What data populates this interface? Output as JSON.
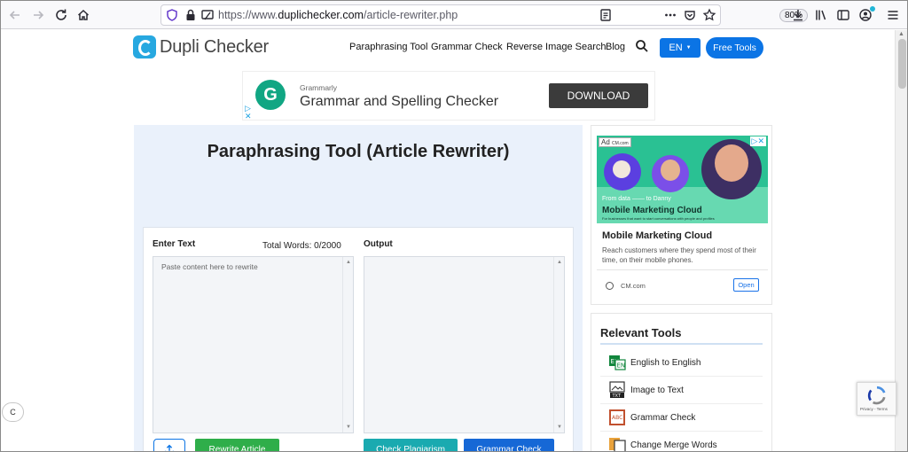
{
  "browser": {
    "url_prefix": "https://www.",
    "url_host": "duplichecker.com",
    "url_path": "/article-rewriter.php",
    "zoom": "80%",
    "icons": [
      "back-icon",
      "forward-icon",
      "reload-icon",
      "home-icon",
      "tracking-shield-icon",
      "lock-icon",
      "permissions-icon",
      "reader-icon",
      "more-icon",
      "pocket-icon",
      "bookmark-star-icon",
      "downloads-icon",
      "library-icon",
      "sidebar-icon",
      "account-icon",
      "menu-icon"
    ]
  },
  "site": {
    "logo_text": "Dupli Checker",
    "nav": [
      "Paraphrasing Tool",
      "Grammar Check",
      "Reverse Image Search",
      "Blog"
    ],
    "lang_label": "EN",
    "free_tools_label": "Free Tools",
    "accent": "#0b74e5"
  },
  "top_ad": {
    "logo_letter": "G",
    "brand": "Grammarly",
    "title": "Grammar and Spelling Checker",
    "cta": "DOWNLOAD",
    "brand_color": "#11a683"
  },
  "tool": {
    "title": "Paraphrasing Tool (Article Rewriter)",
    "input_label": "Enter Text",
    "word_count_label": "Total Words:",
    "word_count_value": "0/2000",
    "output_label": "Output",
    "input_placeholder": "Paste content here to rewrite",
    "buttons": {
      "rewrite": "Rewrite Article",
      "check_plagiarism": "Check Plagiarism",
      "grammar_check": "Grammar Check"
    },
    "colors": {
      "rewrite": "#2fae4a",
      "check_plagiarism": "#1aaab0",
      "grammar_check": "#1668d6"
    }
  },
  "side_ad": {
    "tag": "Ad",
    "logo_text": "CM.com",
    "image_line_1": "From data —— to Danny",
    "image_line_2": "Mobile Marketing Cloud",
    "image_line_3": "For businesses that want to start conversations with people and profiles",
    "title": "Mobile Marketing Cloud",
    "body": "Reach customers where they spend most of their time, on their mobile phones.",
    "domain": "CM.com",
    "open_label": "Open"
  },
  "relevant_tools": {
    "title": "Relevant Tools",
    "items": [
      {
        "label": "English to English",
        "icon": "english-to-english-icon"
      },
      {
        "label": "Image to Text",
        "icon": "image-to-text-icon"
      },
      {
        "label": "Grammar Check",
        "icon": "grammar-check-icon"
      },
      {
        "label": "Change Merge Words",
        "icon": "change-merge-words-icon"
      }
    ]
  },
  "recaptcha": {
    "footer": "Privacy - Terms"
  },
  "chat_widget": {
    "label": "C"
  }
}
